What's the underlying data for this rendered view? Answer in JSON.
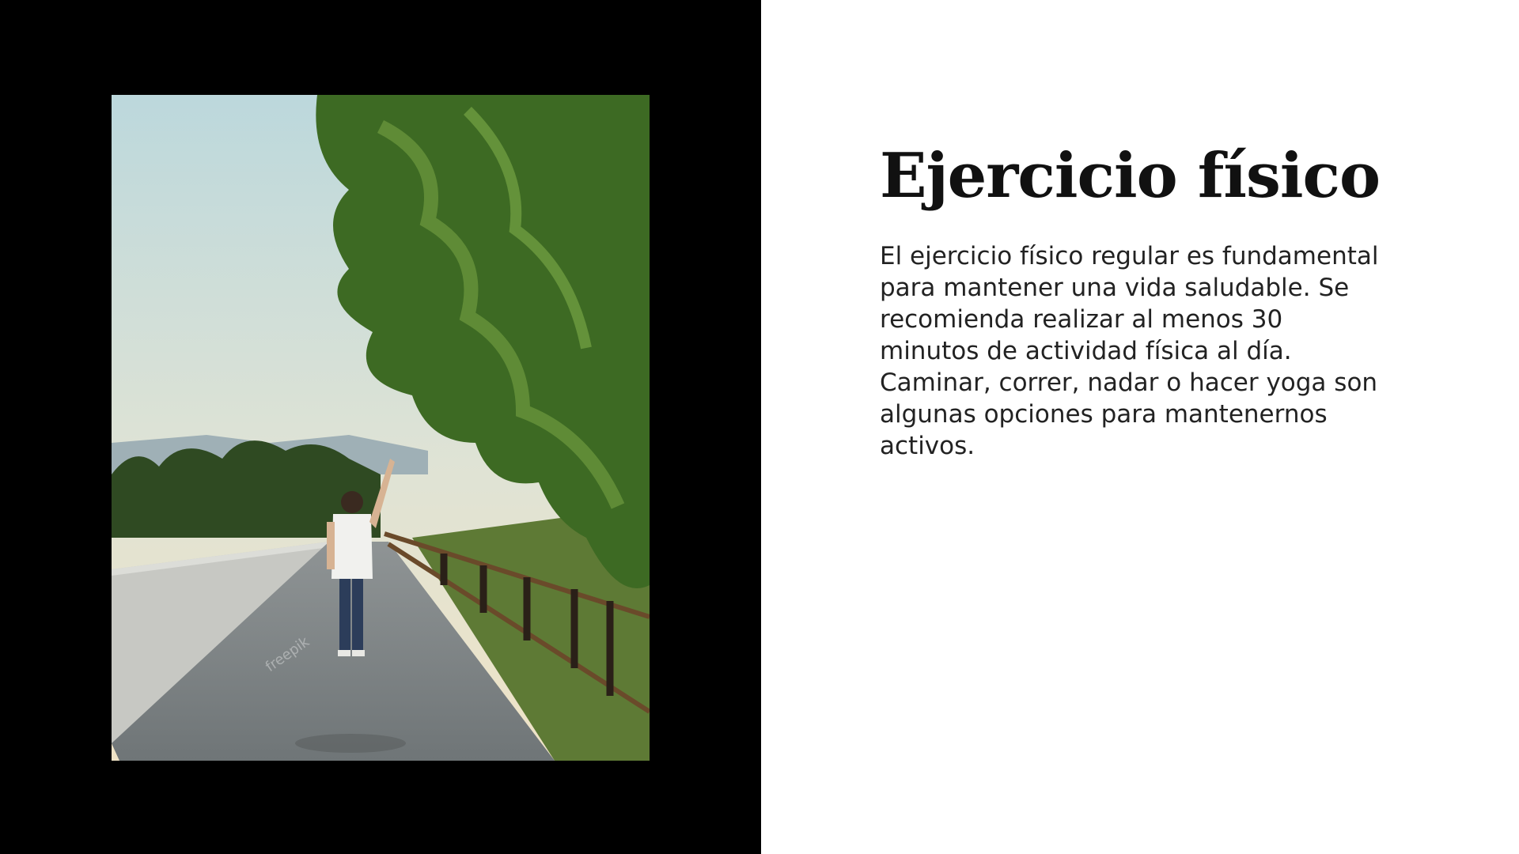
{
  "slide": {
    "title": "Ejercicio físico",
    "body": "El ejercicio físico regular es fundamental para mantener una vida saludable. Se recomienda realizar al menos 30 minutos de actividad física al día. Caminar, correr, nadar o hacer yoga son algunas opciones para mantenernos activos.",
    "photo_watermark": "freepik"
  },
  "colors": {
    "left_background": "#000000",
    "right_background": "#ffffff",
    "title_color": "#111111",
    "body_color": "#222222"
  }
}
